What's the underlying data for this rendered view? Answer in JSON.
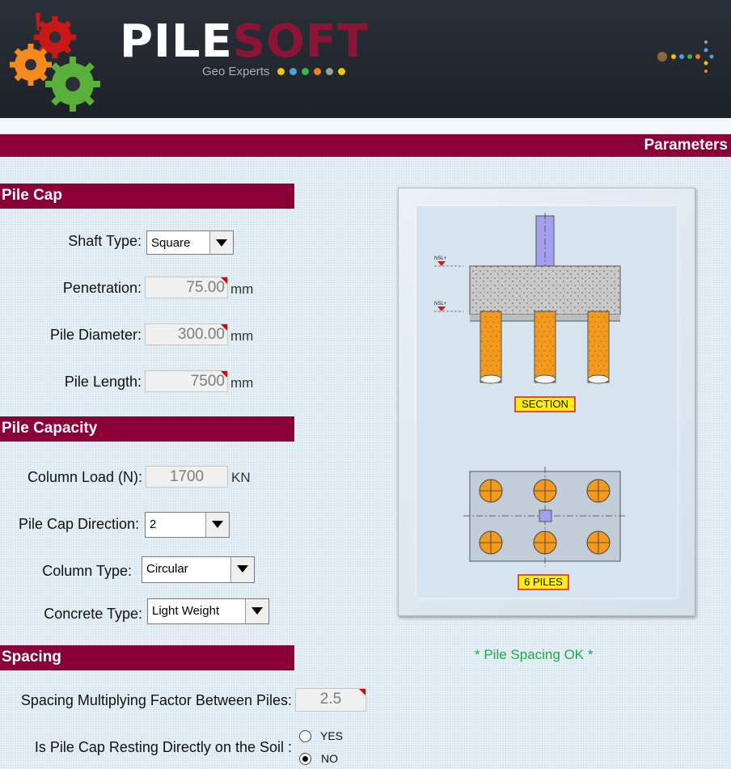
{
  "header": {
    "brand_part1": "PILE",
    "brand_part2": "SOFT",
    "tagline": "Geo Experts",
    "dot_colors": [
      "#f5c400",
      "#4aa3e0",
      "#3bb54a",
      "#f07f20",
      "#9aa0a8",
      "#f5c400"
    ],
    "logo_icon": "gears-icon",
    "decor_icon": "dots-arrow-icon"
  },
  "parameters_bar": {
    "label": "Parameters"
  },
  "pile_cap": {
    "title": "Pile Cap",
    "shaft_type": {
      "label": "Shaft Type:",
      "value": "Square"
    },
    "penetration": {
      "label": "Penetration:",
      "value": "75.00",
      "unit": "mm"
    },
    "pile_diameter": {
      "label": "Pile Diameter:",
      "value": "300.00",
      "unit": "mm"
    },
    "pile_length": {
      "label": "Pile Length:",
      "value": "7500",
      "unit": "mm"
    }
  },
  "pile_capacity": {
    "title": "Pile Capacity",
    "column_load": {
      "label": "Column Load (N):",
      "value": "1700",
      "unit": "KN"
    },
    "pile_cap_direction": {
      "label": "Pile Cap Direction:",
      "value": "2"
    },
    "column_type": {
      "label": "Column Type:",
      "value": "Circular"
    },
    "concrete_type": {
      "label": "Concrete Type:",
      "value": "Light Weight"
    }
  },
  "spacing": {
    "title": "Spacing",
    "multiplying_factor": {
      "label": "Spacing Multiplying Factor Between Piles:",
      "value": "2.5"
    },
    "resting_on_soil": {
      "label": "Is Pile Cap Resting Directly on the Soil :",
      "options": [
        "YES",
        "NO"
      ],
      "selected": "NO"
    }
  },
  "diagram": {
    "section_label": "SECTION",
    "plan_label": "6 PILES",
    "level_marker": "NSL+",
    "pile_count": 6
  },
  "status_text": "* Pile Spacing OK *",
  "colors": {
    "accent": "#8b0036",
    "pile_orange": "#f39a1e",
    "column_purple": "#a59ff0",
    "status_green": "#21a84a"
  }
}
